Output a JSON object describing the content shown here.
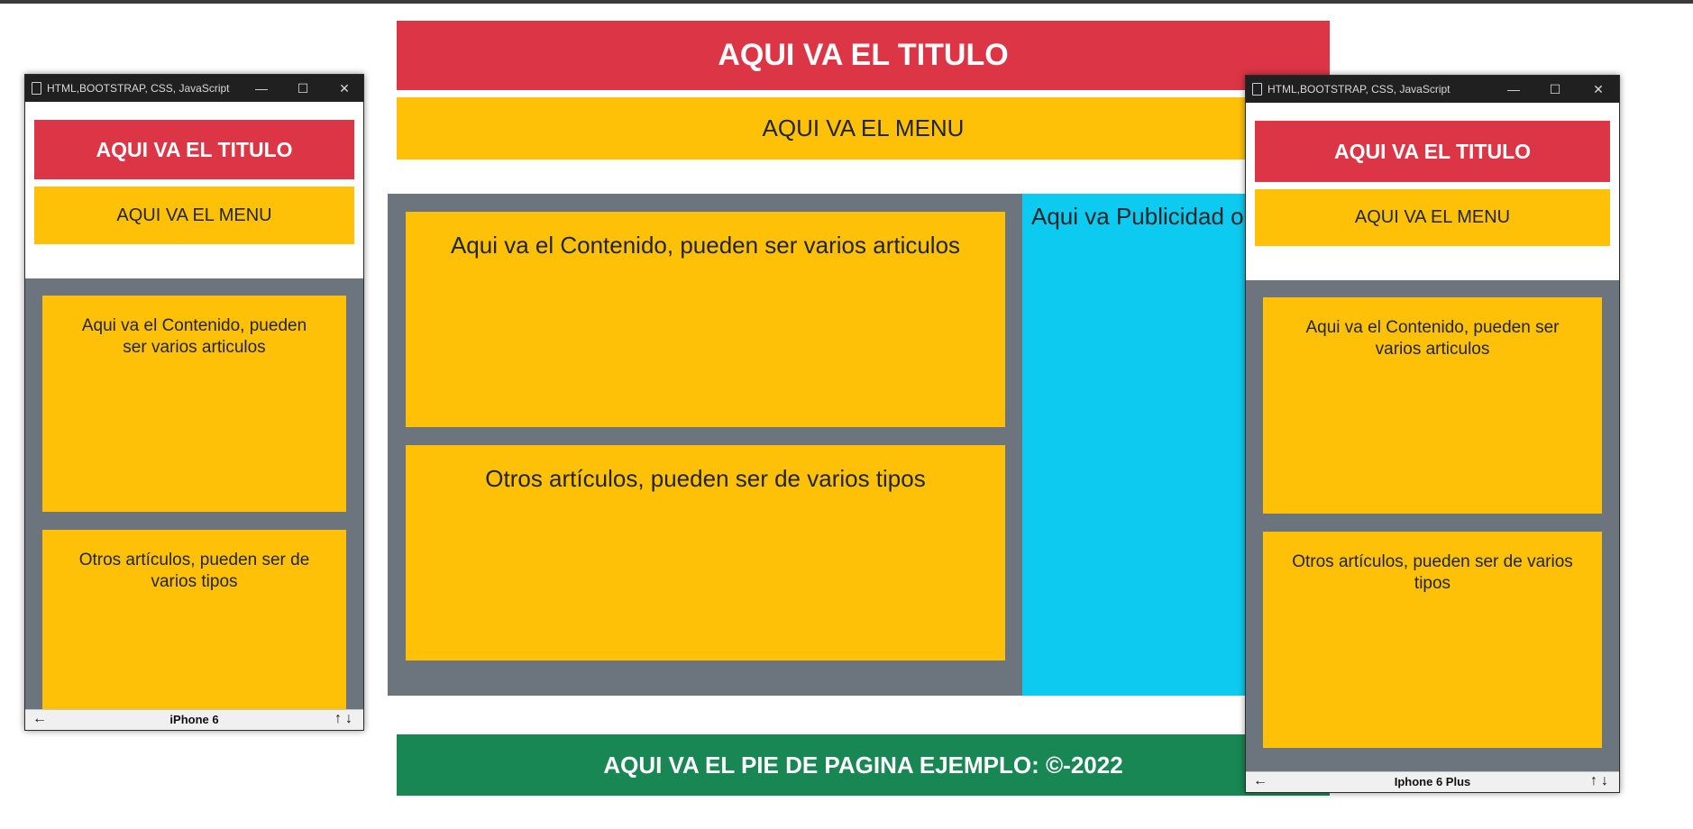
{
  "main_page": {
    "title": "AQUI VA EL TITULO",
    "menu": "AQUI VA EL MENU",
    "articles": [
      "Aqui va el Contenido, pueden ser varios articulos",
      "Otros artículos, pueden ser de varios tipos"
    ],
    "aside": "Aqui va Publicidad o",
    "footer": "AQUI VA EL PIE DE PAGINA EJEMPLO: ©-2022"
  },
  "emulator_left": {
    "window_title": "HTML,BOOTSTRAP, CSS, JavaScript",
    "device": "iPhone 6",
    "page": {
      "title": "AQUI VA EL TITULO",
      "menu": "AQUI VA EL MENU",
      "articles": [
        "Aqui va el Contenido, pueden ser varios articulos",
        "Otros artículos, pueden ser de varios tipos"
      ]
    }
  },
  "emulator_right": {
    "window_title": "HTML,BOOTSTRAP, CSS, JavaScript",
    "device": "Iphone 6 Plus",
    "page": {
      "title": "AQUI VA EL TITULO",
      "menu": "AQUI VA EL MENU",
      "articles": [
        "Aqui va el Contenido, pueden ser varios articulos",
        "Otros artículos, pueden ser de varios tipos"
      ]
    }
  },
  "window_controls": {
    "minimize": "—",
    "maximize": "☐",
    "close": "✕",
    "back": "←",
    "arrows": "↑↓"
  },
  "colors": {
    "title_red": "#dc3545",
    "menu_yellow": "#ffc107",
    "content_gray": "#6c757d",
    "aside_cyan": "#0dcaf0",
    "footer_green": "#198754"
  }
}
